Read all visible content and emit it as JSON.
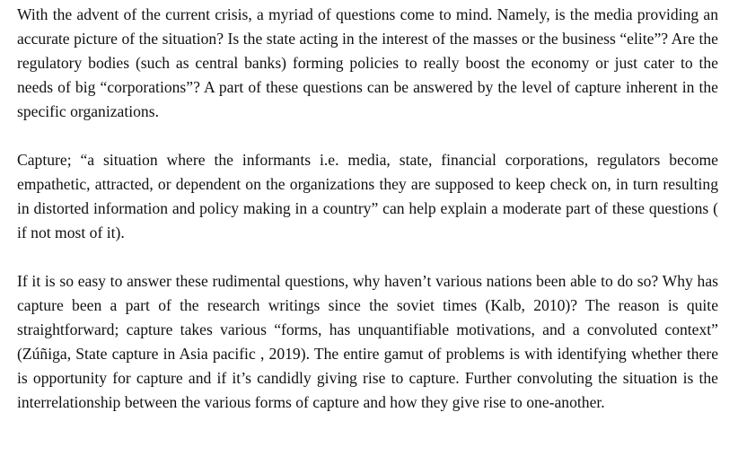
{
  "document": {
    "paragraphs": [
      "With the advent of the current crisis, a myriad of questions come to mind. Namely, is the media providing an accurate picture of the situation? Is the state acting in the interest of the masses or the business “elite”? Are the regulatory bodies (such as central banks) forming policies to really boost the economy or just cater to the needs of big “corporations”? A part of these questions can be answered by the level of capture inherent in the specific organizations.",
      "Capture; “a situation where the informants i.e. media, state, financial corporations, regulators become empathetic, attracted, or dependent on the organizations they are supposed to keep check on, in turn resulting in distorted information and policy making in a country” can help explain a moderate part of these questions ( if not most of it).",
      "If it is so easy to answer these rudimental questions, why haven’t various nations been able to do so? Why has capture been a part of the research writings since the soviet times (Kalb, 2010)? The reason is quite straightforward; capture takes various “forms, has unquantifiable motivations, and a convoluted context” (Zúñiga, State capture in Asia pacific , 2019). The entire gamut of problems is with identifying whether there is opportunity for capture and if it’s candidly giving rise to capture. Further convoluting the situation is the interrelationship between the various forms of capture and how they give rise to one-another."
    ]
  }
}
